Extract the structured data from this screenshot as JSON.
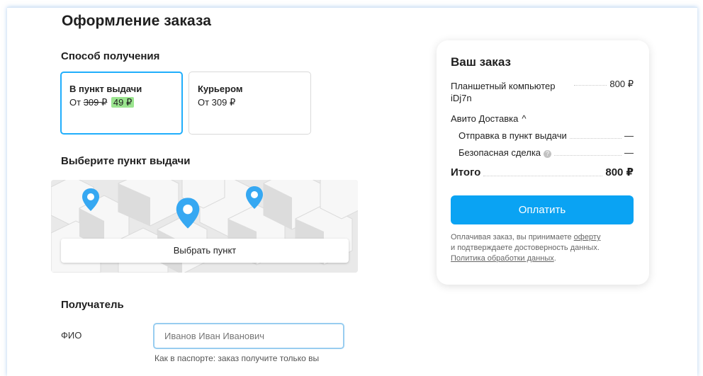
{
  "page": {
    "title": "Оформление заказа"
  },
  "delivery": {
    "heading": "Способ получения",
    "options": [
      {
        "title": "В пункт выдачи",
        "prefix": "От",
        "old_price": "309 ₽",
        "new_price": "49 ₽"
      },
      {
        "title": "Курьером",
        "price": "От 309 ₽"
      }
    ]
  },
  "pickup": {
    "heading": "Выберите пункт выдачи",
    "button_label": "Выбрать пункт"
  },
  "recipient": {
    "heading": "Получатель",
    "fio_label": "ФИО",
    "fio_placeholder": "Иванов Иван Иванович",
    "fio_hint": "Как в паспорте: заказ получите только вы"
  },
  "order": {
    "title": "Ваш заказ",
    "item_name": "Планшетный компьютер iDj7n",
    "item_price": "800 ₽",
    "delivery_label": "Авито Доставка",
    "delivery_chevron": "^",
    "send_label": "Отправка в пункт выдачи",
    "send_value": "—",
    "safe_label": "Безопасная сделка",
    "safe_value": "—",
    "total_label": "Итого",
    "total_value": "800 ₽",
    "pay_label": "Оплатить",
    "legal_1": "Оплачивая заказ, вы принимаете ",
    "legal_link_1": "оферту",
    "legal_2": "и подтверждаете достоверность данных.",
    "legal_link_2": "Политика обработки данных",
    "legal_3": "."
  },
  "colors": {
    "accent": "#0aa3f3",
    "selected_border": "#20aefc",
    "discount_badge": "#9be58f",
    "map_pin": "#36a8f2"
  },
  "icons": {
    "map_pin": "location-pin-icon",
    "help": "question-circle-icon",
    "chevron": "chevron-up-icon"
  }
}
